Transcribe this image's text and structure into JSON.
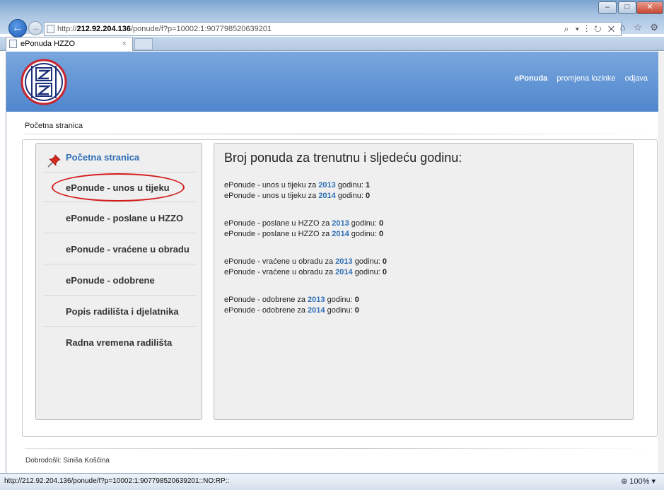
{
  "browser": {
    "url_prefix": "http://",
    "url_host": "212.92.204.136",
    "url_path": "/ponude/f?p=10002:1:907798520639201",
    "tab_title": "ePonuda HZZO",
    "tab_close": "×",
    "status_url": "http://212.92.204.136/ponude/f?p=10002:1:907798520639201::NO:RP::",
    "zoom": "100%",
    "minimize": "–",
    "maximize": "□",
    "close": "✕",
    "back_icon": "←",
    "fwd_icon": "→",
    "addr_tools": "⌕ ▾ ⋮ ↻ ✕",
    "fav_icons": "⌂ ☆ ⚙"
  },
  "header": {
    "nav": [
      {
        "label": "ePonuda",
        "active": true
      },
      {
        "label": "promjena lozinke",
        "active": false
      },
      {
        "label": "odjava",
        "active": false
      }
    ]
  },
  "breadcrumb": "Početna stranica",
  "sidebar": {
    "heading": "Početna stranica",
    "items": [
      "ePonude - unos u tijeku",
      "ePonude - poslane u HZZO",
      "ePonude - vraćene u obradu",
      "ePonude - odobrene",
      "Popis radilišta i djelatnika",
      "Radna vremena radilišta"
    ]
  },
  "main": {
    "title": "Broj ponuda za trenutnu i sljedeću godinu:",
    "groups": [
      {
        "lines": [
          {
            "prefix": "ePonude - unos u tijeku za ",
            "year": "2013",
            "suffix": " godinu: ",
            "count": "1"
          },
          {
            "prefix": "ePonude - unos u tijeku za ",
            "year": "2014",
            "suffix": " godinu: ",
            "count": "0"
          }
        ]
      },
      {
        "lines": [
          {
            "prefix": "ePonude - poslane u HZZO za ",
            "year": "2013",
            "suffix": " godinu: ",
            "count": "0"
          },
          {
            "prefix": "ePonude - poslane u HZZO za ",
            "year": "2014",
            "suffix": " godinu: ",
            "count": "0"
          }
        ]
      },
      {
        "lines": [
          {
            "prefix": "ePonude - vraćene u obradu za ",
            "year": "2013",
            "suffix": " godinu: ",
            "count": "0"
          },
          {
            "prefix": "ePonude - vraćene u obradu za ",
            "year": "2014",
            "suffix": " godinu: ",
            "count": "0"
          }
        ]
      },
      {
        "lines": [
          {
            "prefix": "ePonude - odobrene za ",
            "year": "2013",
            "suffix": " godinu: ",
            "count": "0"
          },
          {
            "prefix": "ePonude - odobrene za ",
            "year": "2014",
            "suffix": " godinu: ",
            "count": "0"
          }
        ]
      }
    ]
  },
  "footer": {
    "welcome": "Dobrodošli: Siniša Koščina"
  },
  "colors": {
    "banner": "#4f86cd",
    "link": "#2f6fb6",
    "highlight_oval": "#d31a1a"
  }
}
